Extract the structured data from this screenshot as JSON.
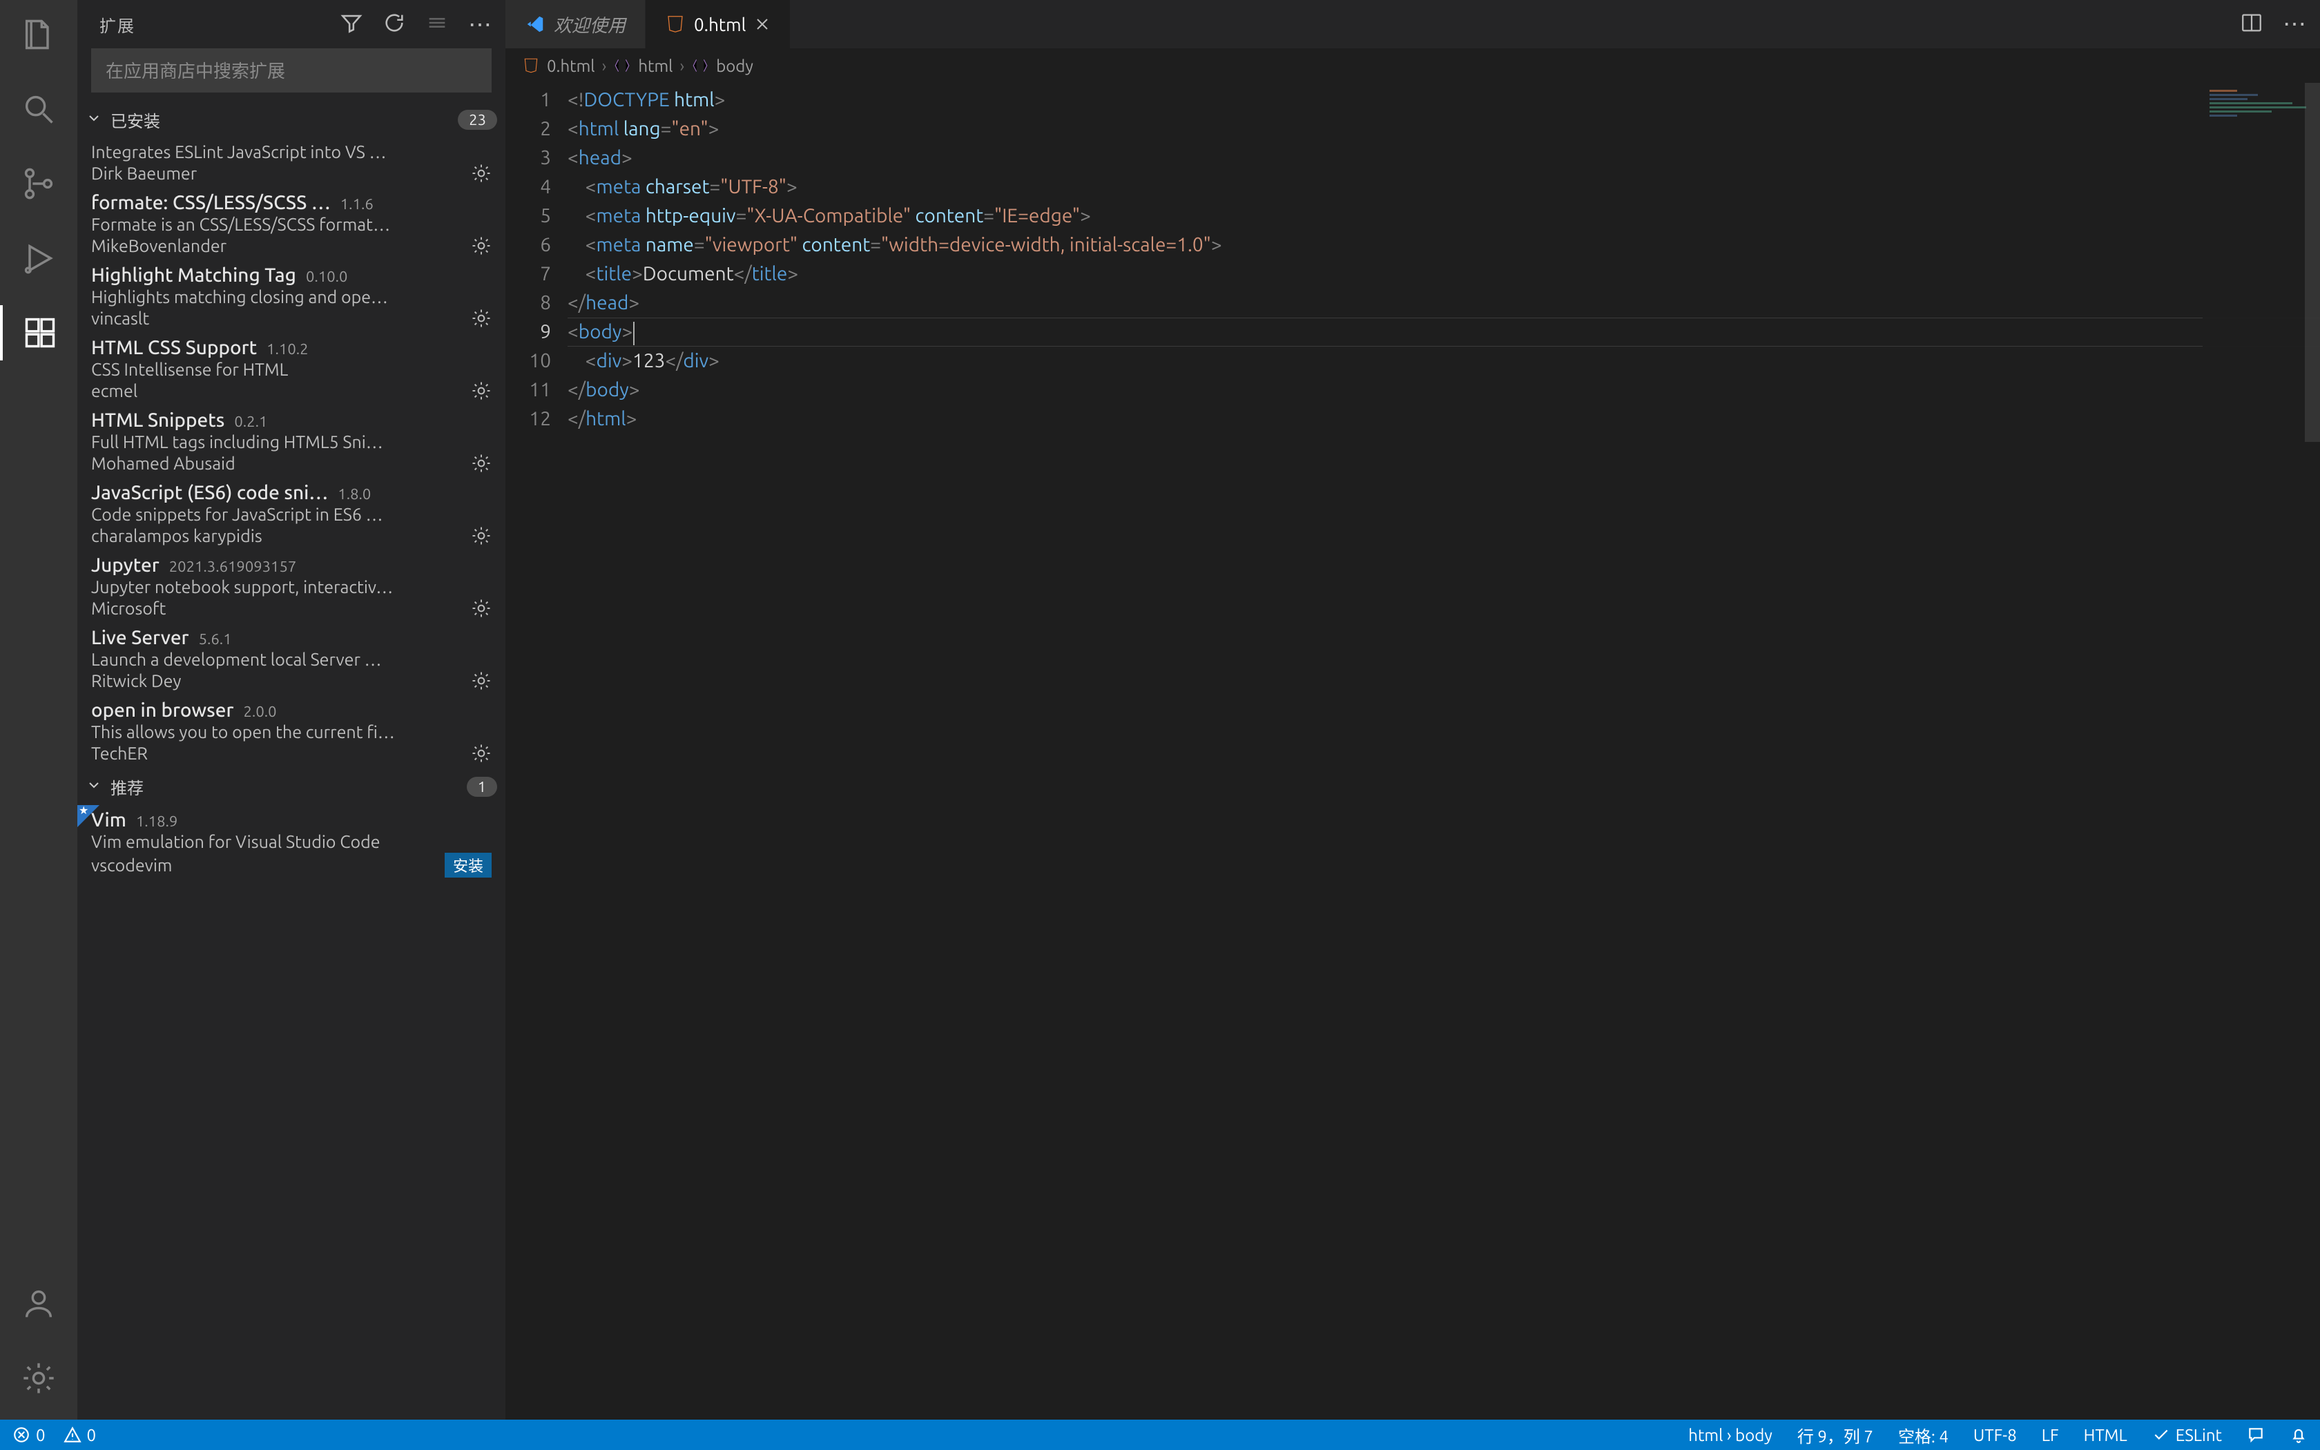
{
  "activitybar": {
    "items": [
      "explorer",
      "search",
      "source-control",
      "run-debug",
      "extensions"
    ],
    "active": "extensions",
    "bottom": [
      "account",
      "settings"
    ]
  },
  "sidebar": {
    "title": "扩展",
    "search_placeholder": "在应用商店中搜索扩展",
    "installed": {
      "label": "已安装",
      "badge": "23",
      "items": [
        {
          "name": "",
          "ver": "",
          "desc": "Integrates ESLint JavaScript into VS …",
          "author": "Dirk Baeumer"
        },
        {
          "name": "formate: CSS/LESS/SCSS …",
          "ver": "1.1.6",
          "desc": "Formate is an CSS/LESS/SCSS format…",
          "author": "MikeBovenlander"
        },
        {
          "name": "Highlight Matching Tag",
          "ver": "0.10.0",
          "desc": "Highlights matching closing and ope…",
          "author": "vincaslt"
        },
        {
          "name": "HTML CSS Support",
          "ver": "1.10.2",
          "desc": "CSS Intellisense for HTML",
          "author": "ecmel"
        },
        {
          "name": "HTML Snippets",
          "ver": "0.2.1",
          "desc": "Full HTML tags including HTML5 Sni…",
          "author": "Mohamed Abusaid"
        },
        {
          "name": "JavaScript (ES6) code sni…",
          "ver": "1.8.0",
          "desc": "Code snippets for JavaScript in ES6 …",
          "author": "charalampos karypidis"
        },
        {
          "name": "Jupyter",
          "ver": "2021.3.619093157",
          "desc": "Jupyter notebook support, interactiv…",
          "author": "Microsoft"
        },
        {
          "name": "Live Server",
          "ver": "5.6.1",
          "desc": "Launch a development local Server …",
          "author": "Ritwick Dey"
        },
        {
          "name": "open in browser",
          "ver": "2.0.0",
          "desc": "This allows you to open the current fi…",
          "author": "TechER"
        }
      ]
    },
    "recommended": {
      "label": "推荐",
      "badge": "1",
      "items": [
        {
          "name": "Vim",
          "ver": "1.18.9",
          "desc": "Vim emulation for Visual Studio Code",
          "author": "vscodevim",
          "install": "安装"
        }
      ]
    }
  },
  "tabs": {
    "items": [
      {
        "label": "欢迎使用",
        "active": false,
        "icon": "vscode"
      },
      {
        "label": "0.html",
        "active": true,
        "icon": "html",
        "closeable": true
      }
    ]
  },
  "breadcrumb": {
    "parts": [
      "0.html",
      "html",
      "body"
    ]
  },
  "editor": {
    "lines": [
      [
        {
          "c": "t-gray",
          "t": "<!"
        },
        {
          "c": "t-doct",
          "t": "DOCTYPE "
        },
        {
          "c": "t-attr",
          "t": "html"
        },
        {
          "c": "t-gray",
          "t": ">"
        }
      ],
      [
        {
          "c": "t-gray",
          "t": "<"
        },
        {
          "c": "t-tag",
          "t": "html "
        },
        {
          "c": "t-attr",
          "t": "lang"
        },
        {
          "c": "t-gray",
          "t": "="
        },
        {
          "c": "t-str",
          "t": "\"en\""
        },
        {
          "c": "t-gray",
          "t": ">"
        }
      ],
      [
        {
          "c": "t-gray",
          "t": "<"
        },
        {
          "c": "t-tag",
          "t": "head"
        },
        {
          "c": "t-gray",
          "t": ">"
        }
      ],
      [
        {
          "c": "",
          "t": "    "
        },
        {
          "c": "t-gray",
          "t": "<"
        },
        {
          "c": "t-tag",
          "t": "meta "
        },
        {
          "c": "t-attr",
          "t": "charset"
        },
        {
          "c": "t-gray",
          "t": "="
        },
        {
          "c": "t-str",
          "t": "\"UTF-8\""
        },
        {
          "c": "t-gray",
          "t": ">"
        }
      ],
      [
        {
          "c": "",
          "t": "    "
        },
        {
          "c": "t-gray",
          "t": "<"
        },
        {
          "c": "t-tag",
          "t": "meta "
        },
        {
          "c": "t-attr",
          "t": "http-equiv"
        },
        {
          "c": "t-gray",
          "t": "="
        },
        {
          "c": "t-str",
          "t": "\"X-UA-Compatible\""
        },
        {
          "c": "",
          "t": " "
        },
        {
          "c": "t-attr",
          "t": "content"
        },
        {
          "c": "t-gray",
          "t": "="
        },
        {
          "c": "t-str",
          "t": "\"IE=edge\""
        },
        {
          "c": "t-gray",
          "t": ">"
        }
      ],
      [
        {
          "c": "",
          "t": "    "
        },
        {
          "c": "t-gray",
          "t": "<"
        },
        {
          "c": "t-tag",
          "t": "meta "
        },
        {
          "c": "t-attr",
          "t": "name"
        },
        {
          "c": "t-gray",
          "t": "="
        },
        {
          "c": "t-str",
          "t": "\"viewport\""
        },
        {
          "c": "",
          "t": " "
        },
        {
          "c": "t-attr",
          "t": "content"
        },
        {
          "c": "t-gray",
          "t": "="
        },
        {
          "c": "t-str",
          "t": "\"width=device-width, initial-scale=1.0\""
        },
        {
          "c": "t-gray",
          "t": ">"
        }
      ],
      [
        {
          "c": "",
          "t": "    "
        },
        {
          "c": "t-gray",
          "t": "<"
        },
        {
          "c": "t-tag",
          "t": "title"
        },
        {
          "c": "t-gray",
          "t": ">"
        },
        {
          "c": "t-text",
          "t": "Document"
        },
        {
          "c": "t-gray",
          "t": "</"
        },
        {
          "c": "t-tag",
          "t": "title"
        },
        {
          "c": "t-gray",
          "t": ">"
        }
      ],
      [
        {
          "c": "t-gray",
          "t": "</"
        },
        {
          "c": "t-tag",
          "t": "head"
        },
        {
          "c": "t-gray",
          "t": ">"
        }
      ],
      [
        {
          "c": "t-gray",
          "t": "<"
        },
        {
          "c": "t-tag",
          "t": "body"
        },
        {
          "c": "t-gray",
          "t": ">"
        }
      ],
      [
        {
          "c": "",
          "t": "    "
        },
        {
          "c": "t-gray",
          "t": "<"
        },
        {
          "c": "t-tag",
          "t": "div"
        },
        {
          "c": "t-gray",
          "t": ">"
        },
        {
          "c": "t-text",
          "t": "123"
        },
        {
          "c": "t-gray",
          "t": "</"
        },
        {
          "c": "t-tag",
          "t": "div"
        },
        {
          "c": "t-gray",
          "t": ">"
        }
      ],
      [
        {
          "c": "t-gray",
          "t": "</"
        },
        {
          "c": "t-tag",
          "t": "body"
        },
        {
          "c": "t-gray",
          "t": ">"
        }
      ],
      [
        {
          "c": "t-gray",
          "t": "</"
        },
        {
          "c": "t-tag",
          "t": "html"
        },
        {
          "c": "t-gray",
          "t": ">"
        }
      ]
    ],
    "active_line": 9
  },
  "status": {
    "errors": "0",
    "warnings": "0",
    "breadcrumb": "html › body",
    "cursor": "行 9，列 7",
    "spaces": "空格: 4",
    "encoding": "UTF-8",
    "eol": "LF",
    "language": "HTML",
    "eslint": "ESLint"
  }
}
